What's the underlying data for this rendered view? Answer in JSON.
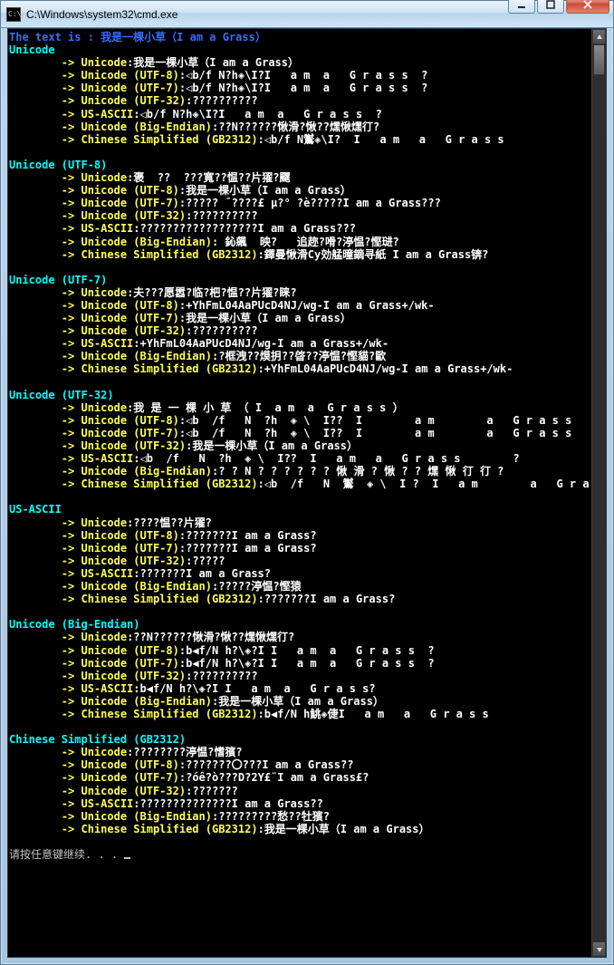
{
  "window": {
    "title": "C:\\Windows\\system32\\cmd.exe",
    "min_tip": "Minimize",
    "max_tip": "Maximize",
    "close_tip": "Close"
  },
  "header_line": {
    "prefix": "The text is : ",
    "value": "我是一棵小草（I am a Grass）"
  },
  "footer": "请按任意键继续. . . ",
  "arrow": "-> ",
  "colon": ":",
  "sections": [
    {
      "name": "Unicode",
      "rows": [
        {
          "enc": "Unicode",
          "val": "我是一棵小草（I am a Grass）"
        },
        {
          "enc": "Unicode (UTF-8)",
          "val": "◁b/f N?h◈\\I?I   a m  a   G r a s s  ?"
        },
        {
          "enc": "Unicode (UTF-7)",
          "val": "◁b/f N?h◈\\I?I   a m  a   G r a s s  ?"
        },
        {
          "enc": "Unicode (UTF-32)",
          "val": "??????????"
        },
        {
          "enc": "US-ASCII",
          "val": "◁b/f N?h◈\\I?I   a m  a   G r a s s  ?"
        },
        {
          "enc": "Unicode (Big-Endian)",
          "val": "??N??????愀滑?愀??㷵愀㷵㣔?"
        },
        {
          "enc": "Chinese Simplified (GB2312)",
          "val": "◁b/f N鸑◈\\I?  I   a m   a   G r a s s"
        }
      ]
    },
    {
      "name": "Unicode (UTF-8)",
      "rows": [
        {
          "enc": "Unicode",
          "val": "褒  ??  ???寬??愠??片㺟?飅"
        },
        {
          "enc": "Unicode (UTF-8)",
          "val": "我是一棵小草（I am a Grass）"
        },
        {
          "enc": "Unicode (UTF-7)",
          "val": "????? ¯????£ μ?° ?è?????I am a Grass???"
        },
        {
          "enc": "Unicode (UTF-32)",
          "val": "??????????"
        },
        {
          "enc": "US-ASCII",
          "val": "??????????????????I am a Grass???"
        },
        {
          "enc": "Unicode (Big-Endian)",
          "val": " 鈊飆  映?   追趂?嗗?渟愠?慳琎?"
        },
        {
          "enc": "Chinese Simplified (GB2312)",
          "val": "鐸曼愀滑Cу効艋曈鏑寻紙 I am a Grass锛?"
        }
      ]
    },
    {
      "name": "Unicode (UTF-7)",
      "rows": [
        {
          "enc": "Unicode",
          "val": "夫???愿嚣?临?杷?愠??片㺟?睐?"
        },
        {
          "enc": "Unicode (UTF-8)",
          "val": "+YhFmL04AaPUcD4NJ/wg-I am a Grass+/wk-"
        },
        {
          "enc": "Unicode (UTF-7)",
          "val": "我是一棵小草（I am a Grass）"
        },
        {
          "enc": "Unicode (UTF-32)",
          "val": "??????????"
        },
        {
          "enc": "US-ASCII",
          "val": "+YhFmL04AaPUcD4NJ/wg-I am a Grass+/wk-"
        },
        {
          "enc": "Unicode (Big-Endian)",
          "val": "?框洩??㷬抈??晵??渟愠?慳貓?歐"
        },
        {
          "enc": "Chinese Simplified (GB2312)",
          "val": "+YhFmL04AaPUcD4NJ/wg-I am a Grass+/wk-"
        }
      ]
    },
    {
      "name": "Unicode (UTF-32)",
      "rows": [
        {
          "enc": "Unicode",
          "val": "我 是 一 棵 小 草 （ I  a m  a  G r a s s ）"
        },
        {
          "enc": "Unicode (UTF-8)",
          "val": "◁b  /f   N  ?h  ◈ \\  I??  I        a m        a   G r a s s        ?"
        },
        {
          "enc": "Unicode (UTF-7)",
          "val": "◁b  /f   N  ?h  ◈ \\  I??  I        a m        a   G r a s s        ?"
        },
        {
          "enc": "Unicode (UTF-32)",
          "val": "我是一棵小草（I am a Grass）"
        },
        {
          "enc": "US-ASCII",
          "val": "◁b  /f   N  ?h  ◈ \\  I??  I   a m   a   G r a s s        ?"
        },
        {
          "enc": "Unicode (Big-Endian)",
          "val": "? ? N ? ? ? ? ? ? 愀 滑 ? 愀 ? ? 㷵 愀 㣔 㣔 ?"
        },
        {
          "enc": "Chinese Simplified (GB2312)",
          "val": "◁b  /f   N  鸑  ◈ \\  I ?  I   a m        a   G r a s s"
        }
      ]
    },
    {
      "name": "US-ASCII",
      "rows": [
        {
          "enc": "Unicode",
          "val": "????愠??片㺟?"
        },
        {
          "enc": "Unicode (UTF-8)",
          "val": "???????I am a Grass?"
        },
        {
          "enc": "Unicode (UTF-7)",
          "val": "???????I am a Grass?"
        },
        {
          "enc": "Unicode (UTF-32)",
          "val": "?????"
        },
        {
          "enc": "US-ASCII",
          "val": "???????I am a Grass?"
        },
        {
          "enc": "Unicode (Big-Endian)",
          "val": "?????渟愠?慳猿"
        },
        {
          "enc": "Chinese Simplified (GB2312)",
          "val": "???????I am a Grass?"
        }
      ]
    },
    {
      "name": "Unicode (Big-Endian)",
      "rows": [
        {
          "enc": "Unicode",
          "val": "??N??????愀滑?愀??㷵愀㷵㣔?"
        },
        {
          "enc": "Unicode (UTF-8)",
          "val": "b◀f/N h?\\◈?I I   a m  a   G r a s s  ?"
        },
        {
          "enc": "Unicode (UTF-7)",
          "val": "b◀f/N h?\\◈?I I   a m  a   G r a s s  ?"
        },
        {
          "enc": "Unicode (UTF-32)",
          "val": "??????????"
        },
        {
          "enc": "US-ASCII",
          "val": "b◀f/N h?\\◈?I I   a m  a   G r a s s?"
        },
        {
          "enc": "Unicode (Big-Endian)",
          "val": "我是一棵小草（I am a Grass）"
        },
        {
          "enc": "Chinese Simplified (GB2312)",
          "val": "b◀f/N h鮡◈倢I   a m   a   G r a s s"
        }
      ]
    },
    {
      "name": "Chinese Simplified (GB2312)",
      "rows": [
        {
          "enc": "Unicode",
          "val": "????????渟愠?愭獱?"
        },
        {
          "enc": "Unicode (UTF-8)",
          "val": "???????〇???I am a Grass??"
        },
        {
          "enc": "Unicode (UTF-7)",
          "val": "?óê?ò???D?2Y£¨I am a Grass£?"
        },
        {
          "enc": "Unicode (UTF-32)",
          "val": "???????"
        },
        {
          "enc": "US-ASCII",
          "val": "??????????????I am a Grass??"
        },
        {
          "enc": "Unicode (Big-Endian)",
          "val": "?????????愁??牡獱?"
        },
        {
          "enc": "Chinese Simplified (GB2312)",
          "val": "我是一棵小草（I am a Grass）"
        }
      ]
    }
  ]
}
